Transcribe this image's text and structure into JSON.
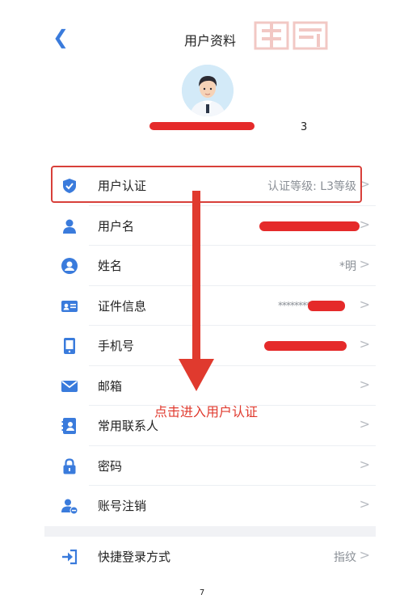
{
  "nav": {
    "back_icon": "chevron-left-icon",
    "title": "用户资料"
  },
  "profile": {
    "avatar_icon": "avatar-icon",
    "name_tail": "3"
  },
  "watermark": "搞懂",
  "rows": [
    {
      "icon": "shield-check-icon",
      "label": "用户认证",
      "value": "认证等级:  L3等级"
    },
    {
      "icon": "person-icon",
      "label": "用户名",
      "value": ""
    },
    {
      "icon": "person-circle-icon",
      "label": "姓名",
      "value": "*明"
    },
    {
      "icon": "id-card-icon",
      "label": "证件信息",
      "value": "***************"
    },
    {
      "icon": "phone-icon",
      "label": "手机号",
      "value": ""
    },
    {
      "icon": "mail-icon",
      "label": "邮箱",
      "value": ""
    },
    {
      "icon": "contacts-icon",
      "label": "常用联系人",
      "value": ""
    },
    {
      "icon": "lock-icon",
      "label": "密码",
      "value": ""
    },
    {
      "icon": "account-remove-icon",
      "label": "账号注销",
      "value": ""
    },
    {
      "icon": "login-icon",
      "label": "快捷登录方式",
      "value": "指纹"
    }
  ],
  "chevron": ">",
  "annotation": "点击进入用户认证",
  "page_number": "7",
  "colors": {
    "accent": "#3a7bdc",
    "annotation_red": "#e03a2e",
    "redaction": "#e52a2a"
  }
}
